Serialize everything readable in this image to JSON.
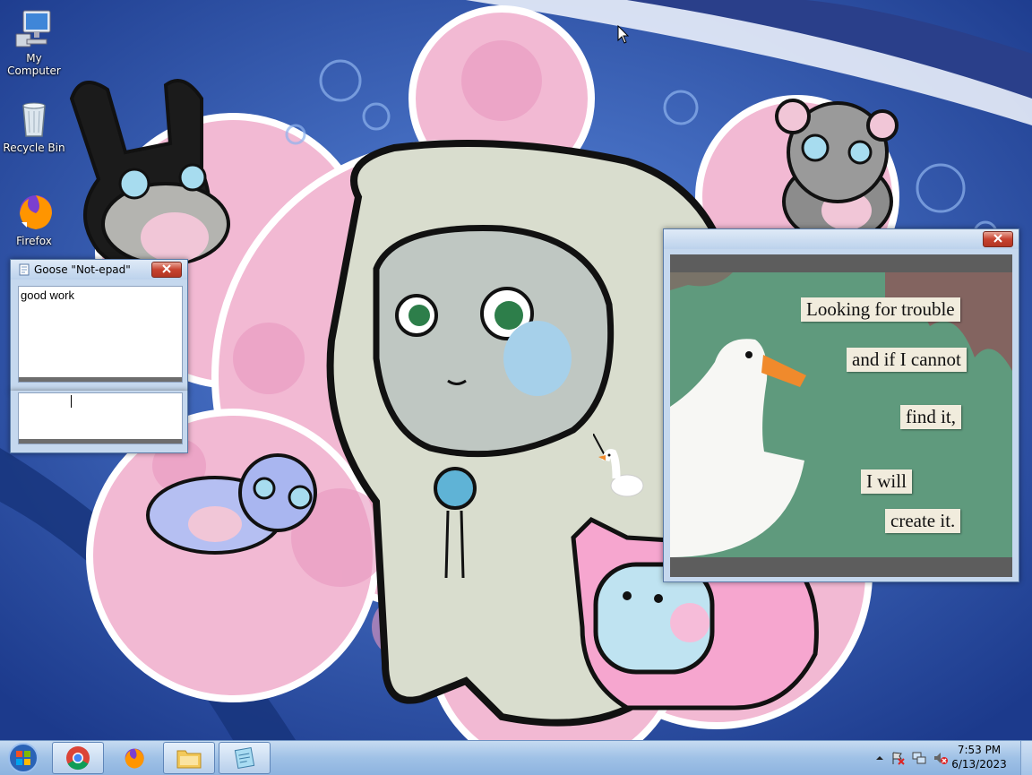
{
  "desktop": {
    "icons": [
      {
        "label": "My Computer",
        "icon": "computer-icon"
      },
      {
        "label": "Recycle Bin",
        "icon": "recycle-bin-icon"
      },
      {
        "label": "Firefox",
        "icon": "firefox-icon"
      }
    ]
  },
  "notepad": {
    "title": "Goose \"Not-epad\"",
    "text": "good work"
  },
  "meme_window": {
    "lines": [
      "Looking for trouble",
      "and if I cannot",
      "find it,",
      "I will",
      "create it."
    ]
  },
  "taskbar": {
    "apps": [
      "chrome-icon",
      "firefox-icon",
      "file-explorer-icon",
      "notepad-icon"
    ],
    "clock": {
      "time": "7:53 PM",
      "date": "6/13/2023"
    }
  },
  "colors": {
    "wallpaper_blue": "#2b4fa6",
    "cloud_pink": "#f2b9d3",
    "meme_green": "#5f9a7d",
    "goose_beak": "#f08a2c",
    "close_red": "#c7422f"
  }
}
